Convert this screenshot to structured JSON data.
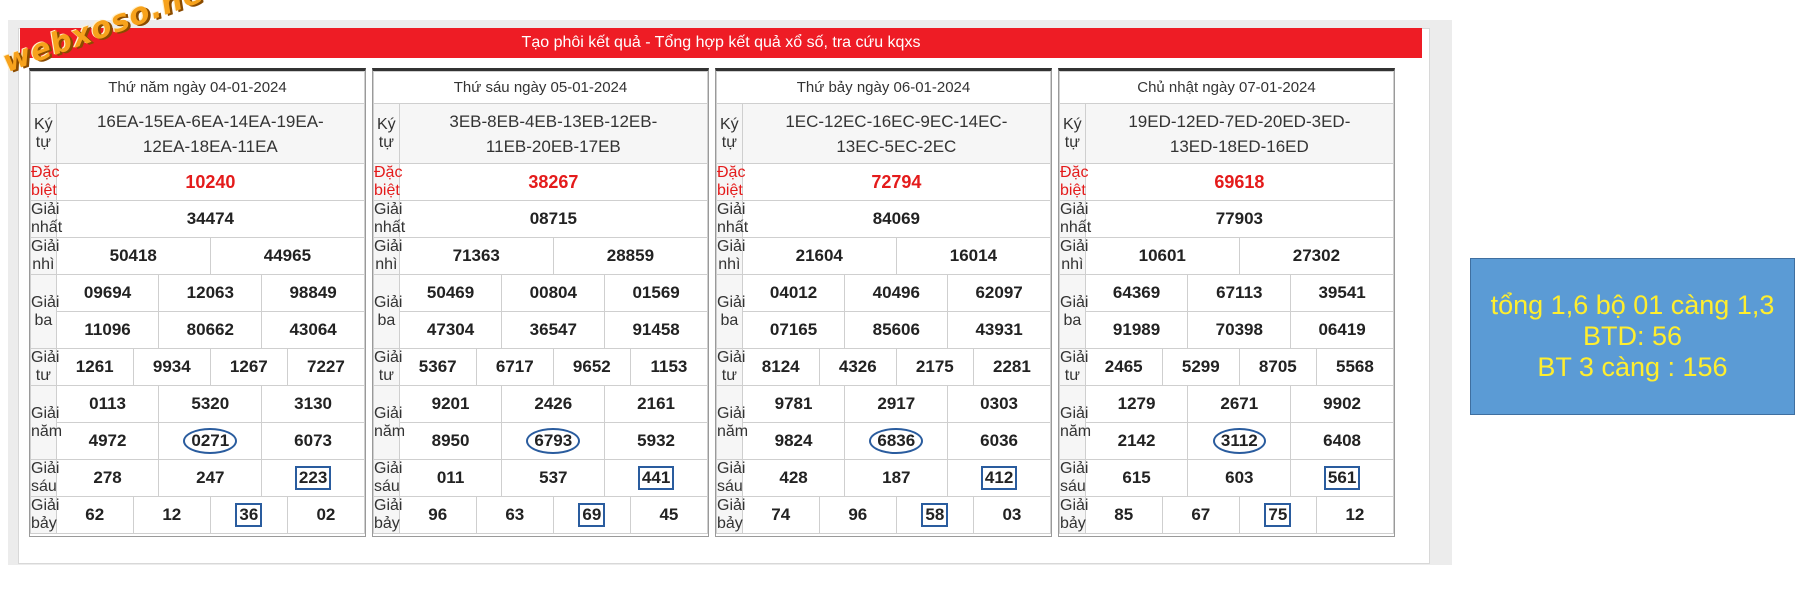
{
  "logo": "webxoso.net",
  "banner": "Tạo phôi kết quả - Tổng hợp kết quả xổ số, tra cứu kqxs",
  "labels": {
    "ky_tu": "Ký tự",
    "dac_biet": "Đặc biệt",
    "giai_nhat": "Giải nhất",
    "giai_nhi": "Giải nhì",
    "giai_ba": "Giải ba",
    "giai_tu": "Giải tư",
    "giai_nam": "Giải năm",
    "giai_sau": "Giải sáu",
    "giai_bay": "Giải bảy"
  },
  "results": [
    {
      "date": "Thứ năm ngày 04-01-2024",
      "ky_tu_l1": "16EA-15EA-6EA-14EA-19EA-",
      "ky_tu_l2": "12EA-18EA-11EA",
      "dac_biet": "10240",
      "giai_nhat": "34474",
      "giai_nhi": [
        "50418",
        "44965"
      ],
      "giai_ba": [
        "09694",
        "12063",
        "98849",
        "11096",
        "80662",
        "43064"
      ],
      "giai_tu": [
        "1261",
        "9934",
        "1267",
        "7227"
      ],
      "giai_nam": [
        "0113",
        "5320",
        "3130",
        "4972",
        "0271",
        "6073"
      ],
      "giai_sau": [
        "278",
        "247",
        "223"
      ],
      "giai_bay": [
        "62",
        "12",
        "36",
        "02"
      ]
    },
    {
      "date": "Thứ sáu ngày 05-01-2024",
      "ky_tu_l1": "3EB-8EB-4EB-13EB-12EB-",
      "ky_tu_l2": "11EB-20EB-17EB",
      "dac_biet": "38267",
      "giai_nhat": "08715",
      "giai_nhi": [
        "71363",
        "28859"
      ],
      "giai_ba": [
        "50469",
        "00804",
        "01569",
        "47304",
        "36547",
        "91458"
      ],
      "giai_tu": [
        "5367",
        "6717",
        "9652",
        "1153"
      ],
      "giai_nam": [
        "9201",
        "2426",
        "2161",
        "8950",
        "6793",
        "5932"
      ],
      "giai_sau": [
        "011",
        "537",
        "441"
      ],
      "giai_bay": [
        "96",
        "63",
        "69",
        "45"
      ]
    },
    {
      "date": "Thứ bảy ngày 06-01-2024",
      "ky_tu_l1": "1EC-12EC-16EC-9EC-14EC-",
      "ky_tu_l2": "13EC-5EC-2EC",
      "dac_biet": "72794",
      "giai_nhat": "84069",
      "giai_nhi": [
        "21604",
        "16014"
      ],
      "giai_ba": [
        "04012",
        "40496",
        "62097",
        "07165",
        "85606",
        "43931"
      ],
      "giai_tu": [
        "8124",
        "4326",
        "2175",
        "2281"
      ],
      "giai_nam": [
        "9781",
        "2917",
        "0303",
        "9824",
        "6836",
        "6036"
      ],
      "giai_sau": [
        "428",
        "187",
        "412"
      ],
      "giai_bay": [
        "74",
        "96",
        "58",
        "03"
      ]
    },
    {
      "date": "Chủ nhật ngày 07-01-2024",
      "ky_tu_l1": "19ED-12ED-7ED-20ED-3ED-",
      "ky_tu_l2": "13ED-18ED-16ED",
      "dac_biet": "69618",
      "giai_nhat": "77903",
      "giai_nhi": [
        "10601",
        "27302"
      ],
      "giai_ba": [
        "64369",
        "67113",
        "39541",
        "91989",
        "70398",
        "06419"
      ],
      "giai_tu": [
        "2465",
        "5299",
        "8705",
        "5568"
      ],
      "giai_nam": [
        "1279",
        "2671",
        "9902",
        "2142",
        "3112",
        "6408"
      ],
      "giai_sau": [
        "615",
        "603",
        "561"
      ],
      "giai_bay": [
        "85",
        "67",
        "75",
        "12"
      ]
    }
  ],
  "note": {
    "line1": "tổng 1,6 bộ 01 càng 1,3",
    "line2": "BTD: 56",
    "line3": "BT 3 càng : 156"
  },
  "colors": {
    "banner": "#ee1c25",
    "special_prize": "#e41b1b",
    "note_bg": "#5b9bd5",
    "note_text": "#ffee2e",
    "marker": "#2a5c9e"
  }
}
